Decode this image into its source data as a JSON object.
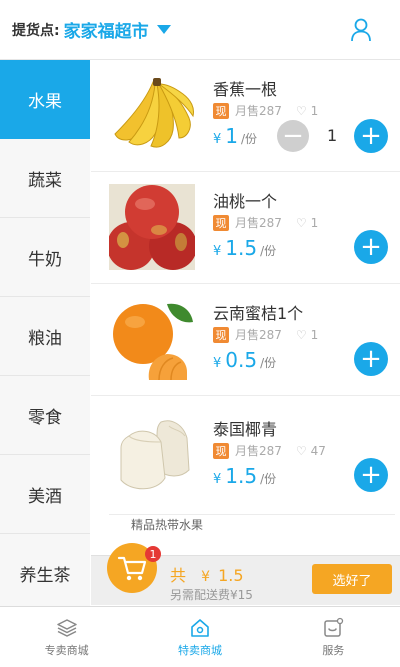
{
  "header": {
    "pickup_label": "提货点:",
    "store_name": "家家福超市"
  },
  "categories": [
    {
      "label": "水果",
      "active": true
    },
    {
      "label": "蔬菜",
      "active": false
    },
    {
      "label": "牛奶",
      "active": false
    },
    {
      "label": "粮油",
      "active": false
    },
    {
      "label": "零食",
      "active": false
    },
    {
      "label": "美酒",
      "active": false
    },
    {
      "label": "养生茶",
      "active": false
    }
  ],
  "products": [
    {
      "name": "香蕉一根",
      "badge": "现",
      "sold": "月售287",
      "likes": "1",
      "yen": "¥",
      "price": "1",
      "unit": "/份",
      "quantity": "1"
    },
    {
      "name": "油桃一个",
      "badge": "现",
      "sold": "月售287",
      "likes": "1",
      "yen": "¥",
      "price": "1.5",
      "unit": "/份"
    },
    {
      "name": "云南蜜桔1个",
      "badge": "现",
      "sold": "月售287",
      "likes": "1",
      "yen": "¥",
      "price": "0.5",
      "unit": "/份"
    },
    {
      "name": "泰国椰青",
      "badge": "现",
      "sold": "月售287",
      "likes": "47",
      "yen": "¥",
      "price": "1.5",
      "unit": "/份"
    }
  ],
  "section_note": "精品热带水果",
  "cart": {
    "badge_count": "1",
    "total_label": "共",
    "yen": "¥",
    "total_amount": "1.5",
    "delivery_fee": "另需配送费¥15",
    "confirm_label": "选好了"
  },
  "bottom_nav": [
    {
      "label": "专卖商城",
      "icon": "layers-icon",
      "active": false
    },
    {
      "label": "特卖商城",
      "icon": "home-icon",
      "active": true
    },
    {
      "label": "服务",
      "icon": "service-icon",
      "active": false
    }
  ],
  "colors": {
    "accent": "#1aa8e8",
    "cart": "#f5a623",
    "badge": "#f08a33"
  }
}
